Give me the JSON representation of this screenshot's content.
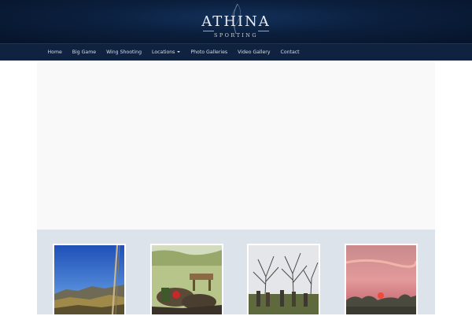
{
  "brand": {
    "title": "ATHINA",
    "subtitle": "SPORTING"
  },
  "nav": {
    "items": [
      {
        "label": "Home",
        "has_dropdown": false
      },
      {
        "label": "Big Game",
        "has_dropdown": false
      },
      {
        "label": "Wing Shooting",
        "has_dropdown": false
      },
      {
        "label": "Locations",
        "has_dropdown": true
      },
      {
        "label": "Photo Galleries",
        "has_dropdown": false
      },
      {
        "label": "Video Gallery",
        "has_dropdown": false
      },
      {
        "label": "Contact",
        "has_dropdown": false
      }
    ]
  },
  "gallery": {
    "thumbnails": [
      {
        "depicts": "mountain landscape with shotgun barrel under blue sky"
      },
      {
        "depicts": "hunting gear and harvested game on grass with table"
      },
      {
        "depicts": "group of hunters with dogs among bare trees"
      },
      {
        "depicts": "pink sunset sky over trees"
      }
    ]
  },
  "colors": {
    "header_bg": "#0b1f3d",
    "nav_bg": "#0f2240",
    "nav_text": "#d8dfe8",
    "slider_bg": "#f9f9f9",
    "gallery_bg": "#dde3eb"
  }
}
